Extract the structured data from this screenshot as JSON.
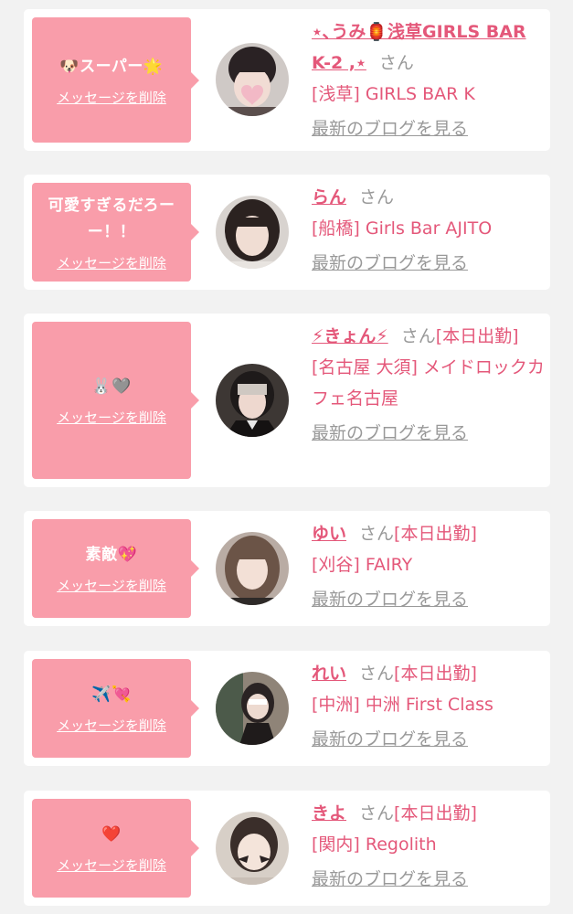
{
  "cards": [
    {
      "message": "🐶スーパー🌟",
      "delete_label": "メッセージを削除",
      "name": "⋆､うみ🏮浅草GIRLS BAR K-2 ,⋆",
      "honorific": "さん",
      "status": "",
      "shop": "[浅草] GIRLS BAR K",
      "blog_link": "最新のブログを見る"
    },
    {
      "message": "可愛すぎるだろーー！！",
      "delete_label": "メッセージを削除",
      "name": "らん",
      "honorific": "さん",
      "status": "",
      "shop": "[船橋] Girls Bar AJITO",
      "blog_link": "最新のブログを見る"
    },
    {
      "message": "🐰🩶",
      "delete_label": "メッセージを削除",
      "name": "⚡きょん⚡",
      "honorific": "さん",
      "status": "[本日出勤]",
      "shop": "[名古屋 大須] メイドロックカフェ名古屋",
      "blog_link": "最新のブログを見る"
    },
    {
      "message": "素敵💖",
      "delete_label": "メッセージを削除",
      "name": "ゆい",
      "honorific": "さん",
      "status": "[本日出勤]",
      "shop": "[刈谷] FAIRY",
      "blog_link": "最新のブログを見る"
    },
    {
      "message": "✈️💘",
      "delete_label": "メッセージを削除",
      "name": "れい",
      "honorific": "さん",
      "status": "[本日出勤]",
      "shop": "[中洲] 中洲 First Class",
      "blog_link": "最新のブログを見る"
    },
    {
      "message": "❤️",
      "delete_label": "メッセージを削除",
      "name": "きよ",
      "honorific": "さん",
      "status": "[本日出勤]",
      "shop": "[関内] Regolith",
      "blog_link": "最新のブログを見る"
    }
  ],
  "colors": {
    "bubble": "#f99daa",
    "accent": "#e4587a",
    "muted": "#999999",
    "card": "#ffffff",
    "background": "#f2f2f2"
  }
}
